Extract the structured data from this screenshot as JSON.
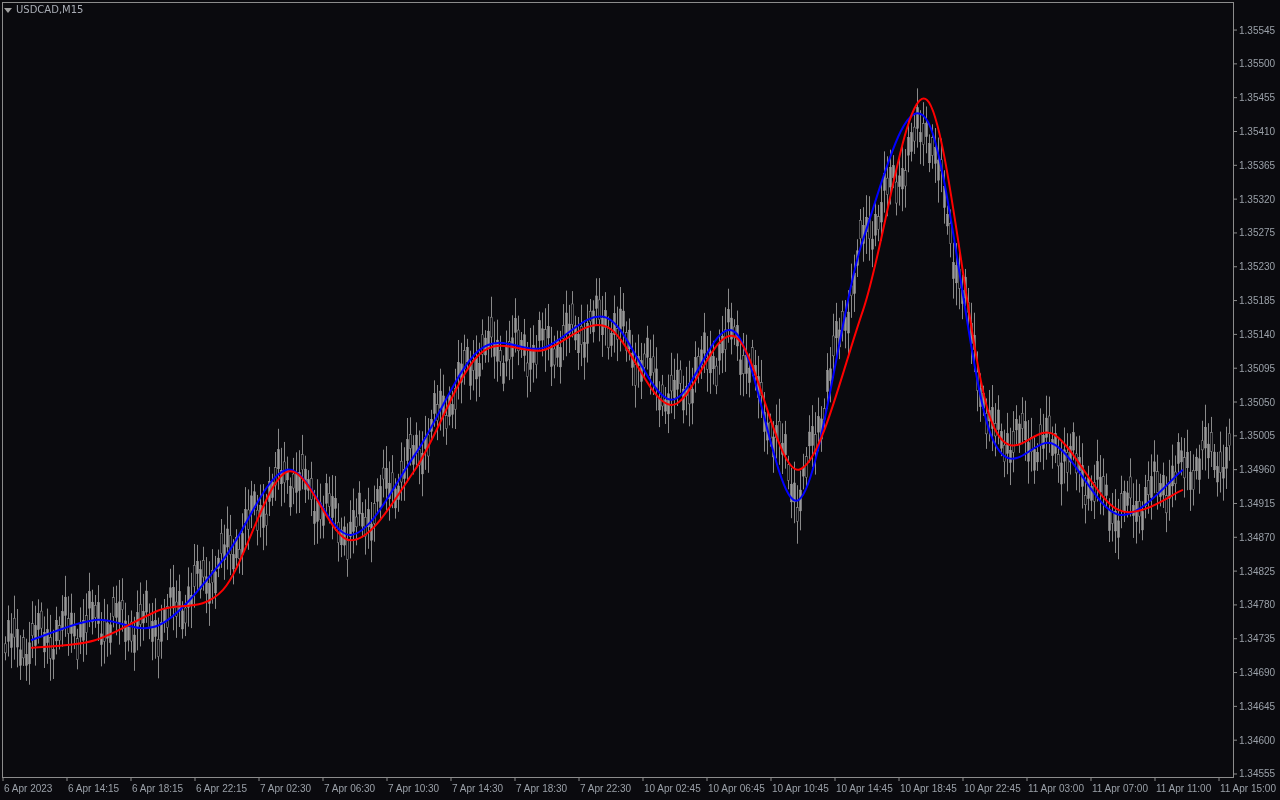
{
  "chart_window": {
    "title": "USDCAD,M15",
    "chart_data": {
      "type": "line",
      "categories": [
        "6 Apr 2023",
        "6 Apr 14:15",
        "6 Apr 18:15",
        "6 Apr 22:15",
        "7 Apr 02:30",
        "7 Apr 06:30",
        "7 Apr 10:30",
        "7 Apr 14:30",
        "7 Apr 18:30",
        "7 Apr 22:30",
        "10 Apr 02:45",
        "10 Apr 06:45",
        "10 Apr 10:45",
        "10 Apr 14:45",
        "10 Apr 18:45",
        "10 Apr 22:45",
        "11 Apr 03:00",
        "11 Apr 07:00",
        "11 Apr 11:00",
        "11 Apr 15:00"
      ],
      "series": [
        {
          "color": "#0000ff",
          "values": [
            1.34733,
            1.3476,
            1.34753,
            1.3484,
            1.3496,
            1.34873,
            1.3498,
            1.35119,
            1.35122,
            1.35162,
            1.35053,
            1.35143,
            1.3492,
            1.35266,
            1.35425,
            1.35006,
            1.34993,
            1.349,
            1.3496,
            null
          ]
        },
        {
          "color": "#ff0000",
          "values": [
            1.34723,
            1.34733,
            1.34773,
            1.348,
            1.34957,
            1.34866,
            1.3496,
            1.35113,
            1.35119,
            1.3515,
            1.35046,
            1.35137,
            1.3496,
            1.35172,
            1.35452,
            1.35026,
            1.35006,
            1.34906,
            1.34933,
            null
          ]
        }
      ],
      "ylim": [
        1.34551,
        1.35581
      ],
      "yticks": [
        {
          "value": 1.34555,
          "label": "1.34555"
        },
        {
          "value": 1.346,
          "label": "1.34600"
        },
        {
          "value": 1.34645,
          "label": "1.34645"
        },
        {
          "value": 1.3469,
          "label": "1.34690"
        },
        {
          "value": 1.34735,
          "label": "1.34735"
        },
        {
          "value": 1.3478,
          "label": "1.34780"
        },
        {
          "value": 1.34825,
          "label": "1.34825"
        },
        {
          "value": 1.3487,
          "label": "1.34870"
        },
        {
          "value": 1.34915,
          "label": "1.34915"
        },
        {
          "value": 1.3496,
          "label": "1.34960"
        },
        {
          "value": 1.35005,
          "label": "1.35005"
        },
        {
          "value": 1.3505,
          "label": "1.35050"
        },
        {
          "value": 1.35095,
          "label": "1.35095"
        },
        {
          "value": 1.3514,
          "label": "1.35140"
        },
        {
          "value": 1.35185,
          "label": "1.35185"
        },
        {
          "value": 1.3523,
          "label": "1.35230"
        },
        {
          "value": 1.35275,
          "label": "1.35275"
        },
        {
          "value": 1.3532,
          "label": "1.35320"
        },
        {
          "value": 1.35365,
          "label": "1.35365"
        },
        {
          "value": 1.3541,
          "label": "1.35410"
        },
        {
          "value": 1.35455,
          "label": "1.35455"
        },
        {
          "value": 1.355,
          "label": "1.35500"
        },
        {
          "value": 1.35545,
          "label": "1.35545"
        }
      ]
    }
  }
}
